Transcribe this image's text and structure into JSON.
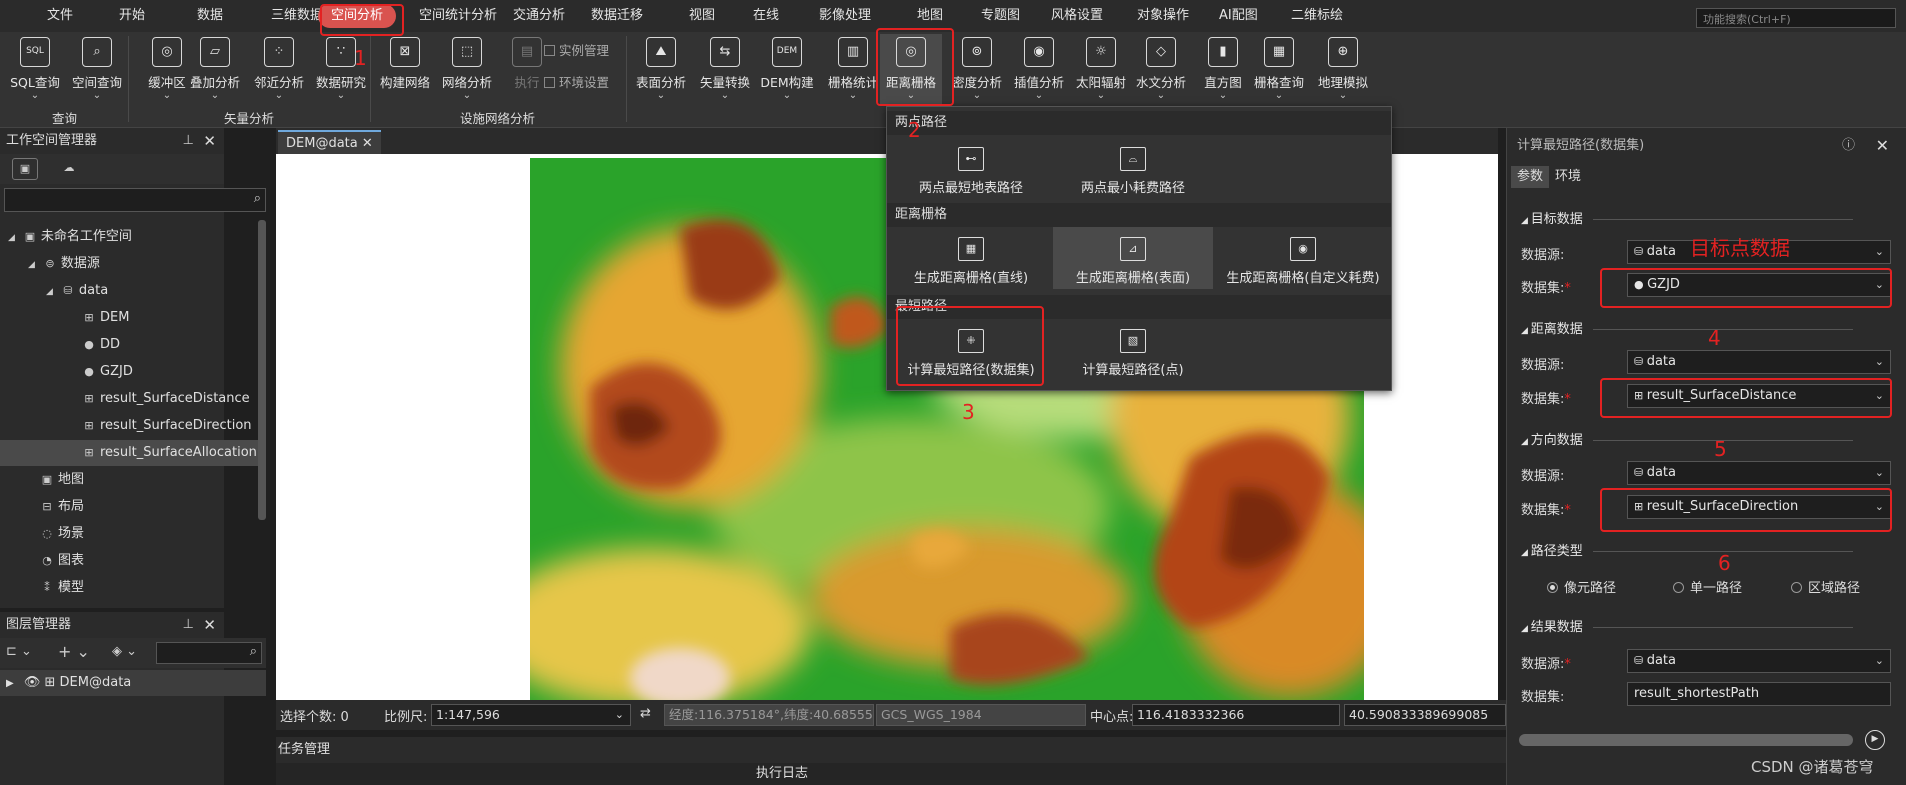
{
  "menu": [
    "文件",
    "开始",
    "数据",
    "三维数据",
    "空间分析",
    "空间统计分析",
    "交通分析",
    "数据迁移",
    "视图",
    "在线",
    "影像处理",
    "地图",
    "专题图",
    "风格设置",
    "对象操作",
    "AI配图",
    "二维标绘"
  ],
  "menu_active_index": 4,
  "menu_search_placeholder": "功能搜索(Ctrl+F)",
  "ribbon": {
    "buttons": [
      "SQL查询",
      "空间查询",
      "缓冲区",
      "叠加分析",
      "邻近分析",
      "数据研究",
      "构建网络",
      "网络分析",
      "执行",
      "表面分析",
      "矢量转换",
      "DEM构建",
      "栅格统计",
      "距离栅格",
      "密度分析",
      "插值分析",
      "太阳辐射",
      "水文分析",
      "直方图",
      "栅格查询",
      "地理模拟"
    ],
    "icons": [
      "SQL",
      "⌕",
      "◎",
      "▱",
      "⁘",
      "∵",
      "⊠",
      "⬚",
      "▤",
      "⛰",
      "⇆",
      "DEM",
      "▥",
      "◎",
      "⊚",
      "◉",
      "☼",
      "◇",
      "▮",
      "▦",
      "⊕"
    ],
    "checkboxes": [
      "实例管理",
      "环境设置"
    ],
    "groups": [
      "查询",
      "矢量分析",
      "设施网络分析"
    ]
  },
  "workspace": {
    "title": "工作空间管理器",
    "tree": [
      {
        "label": "未命名工作空间",
        "icon": "▣"
      },
      {
        "label": "数据源",
        "icon": "⊜"
      },
      {
        "label": "data",
        "icon": "⛁"
      },
      {
        "label": "DEM",
        "icon": "⊞"
      },
      {
        "label": "DD",
        "icon": "●"
      },
      {
        "label": "GZJD",
        "icon": "●"
      },
      {
        "label": "result_SurfaceDistance",
        "icon": "⊞"
      },
      {
        "label": "result_SurfaceDirection",
        "icon": "⊞"
      },
      {
        "label": "result_SurfaceAllocation",
        "icon": "⊞"
      },
      {
        "label": "地图",
        "icon": "▣"
      },
      {
        "label": "布局",
        "icon": "⊟"
      },
      {
        "label": "场景",
        "icon": "◌"
      },
      {
        "label": "图表",
        "icon": "◔"
      },
      {
        "label": "模型",
        "icon": "⁑"
      }
    ]
  },
  "layer_manager": {
    "title": "图层管理器",
    "layer": "DEM@data"
  },
  "doc_tab": "DEM@data",
  "status": {
    "sel_label": "选择个数: 0",
    "scale_label": "比例尺:",
    "scale": "1:147,596",
    "coords": "经度:116.375184°,纬度:40.685551",
    "crs": "GCS_WGS_1984",
    "center_label": "中心点:",
    "center_x": "116.4183332366",
    "center_y": "40.590833389699085"
  },
  "task_label": "任务管理",
  "log_label": "执行日志",
  "dropdown": {
    "sections": [
      "两点路径",
      "距离栅格",
      "最短路径"
    ],
    "items": [
      "两点最短地表路径",
      "两点最小耗费路径",
      "生成距离栅格(直线)",
      "生成距离栅格(表面)",
      "生成距离栅格(自定义耗费)",
      "计算最短路径(数据集)",
      "计算最短路径(点)"
    ]
  },
  "panel": {
    "title": "计算最短路径(数据集)",
    "tabs": [
      "参数",
      "环境"
    ],
    "sections": [
      "目标数据",
      "距离数据",
      "方向数据",
      "路径类型",
      "结果数据"
    ],
    "datasource_label": "数据源:",
    "dataset_label": "数据集:",
    "req": "*",
    "target": {
      "datasource": "data",
      "dataset": "GZJD"
    },
    "distance": {
      "datasource": "data",
      "dataset": "result_SurfaceDistance"
    },
    "direction": {
      "datasource": "data",
      "dataset": "result_SurfaceDirection"
    },
    "path_types": [
      "像元路径",
      "单一路径",
      "区域路径"
    ],
    "result": {
      "datasource": "data",
      "dataset": "result_shortestPath"
    }
  },
  "annotations": {
    "n1": "1",
    "n2": "2",
    "n3": "3",
    "n4": "4",
    "n5": "5",
    "n6": "6",
    "target_note": "目标点数据"
  },
  "watermark": "CSDN @诸葛苍穹",
  "colors": {
    "accent_red": "#e32222",
    "active_menu": "#d9534f"
  }
}
